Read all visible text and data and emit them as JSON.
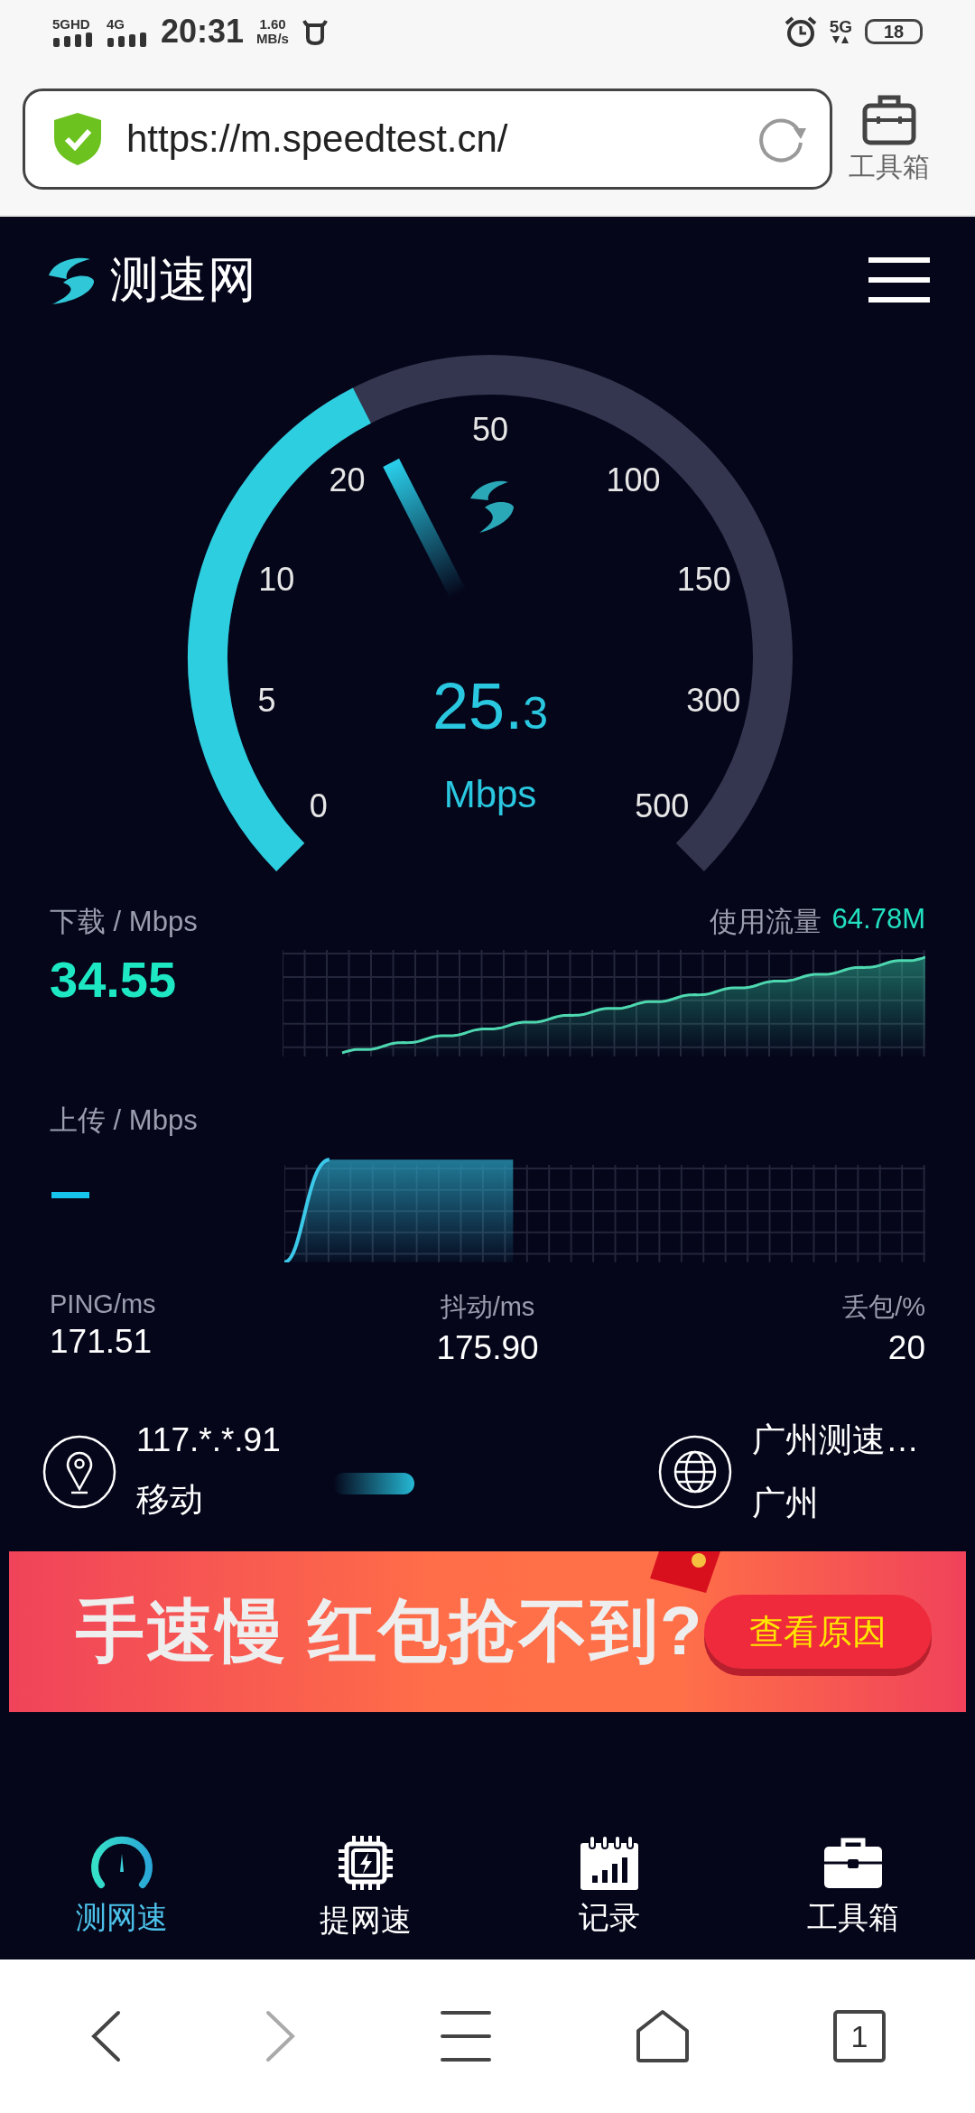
{
  "status_bar": {
    "network_1": "5GHD",
    "network_2": "4G",
    "time": "20:31",
    "speed_value": "1.60",
    "speed_unit": "MB/s",
    "network_3": "5G",
    "battery": "18"
  },
  "address_bar": {
    "url": "https://m.speedtest.cn/",
    "toolbox_label": "工具箱"
  },
  "header": {
    "logo_text": "测速网"
  },
  "gauge": {
    "ticks": [
      "0",
      "5",
      "10",
      "20",
      "50",
      "100",
      "150",
      "300",
      "500"
    ],
    "value_integer": "25.",
    "value_fraction": "3",
    "unit": "Mbps"
  },
  "download": {
    "label": "下载 / Mbps",
    "value": "34.55",
    "usage_label": "使用流量",
    "usage_value": "64.78M"
  },
  "upload": {
    "label": "上传 / Mbps"
  },
  "stats": [
    {
      "label": "PING/ms",
      "value": "171.51"
    },
    {
      "label": "抖动/ms",
      "value": "175.90"
    },
    {
      "label": "丢包/%",
      "value": "20"
    }
  ],
  "client": {
    "ip": "117.*.*.91",
    "isp": "移动"
  },
  "server": {
    "name": "广州测速…",
    "city": "广州"
  },
  "banner": {
    "headline": "手速慢 红包抢不到?",
    "button": "查看原因"
  },
  "nav": [
    {
      "kind": "gauge",
      "label": "测网速",
      "selected": true
    },
    {
      "kind": "chip",
      "label": "提网速",
      "selected": false
    },
    {
      "kind": "calendar",
      "label": "记录",
      "selected": false
    },
    {
      "kind": "toolbox",
      "label": "工具箱",
      "selected": false
    }
  ],
  "browser_nav": [
    {
      "kind": "back",
      "disabled": false
    },
    {
      "kind": "forward",
      "disabled": true
    },
    {
      "kind": "menu",
      "disabled": false
    },
    {
      "kind": "home",
      "disabled": false
    },
    {
      "kind": "tabs",
      "label": "1",
      "disabled": false
    }
  ]
}
